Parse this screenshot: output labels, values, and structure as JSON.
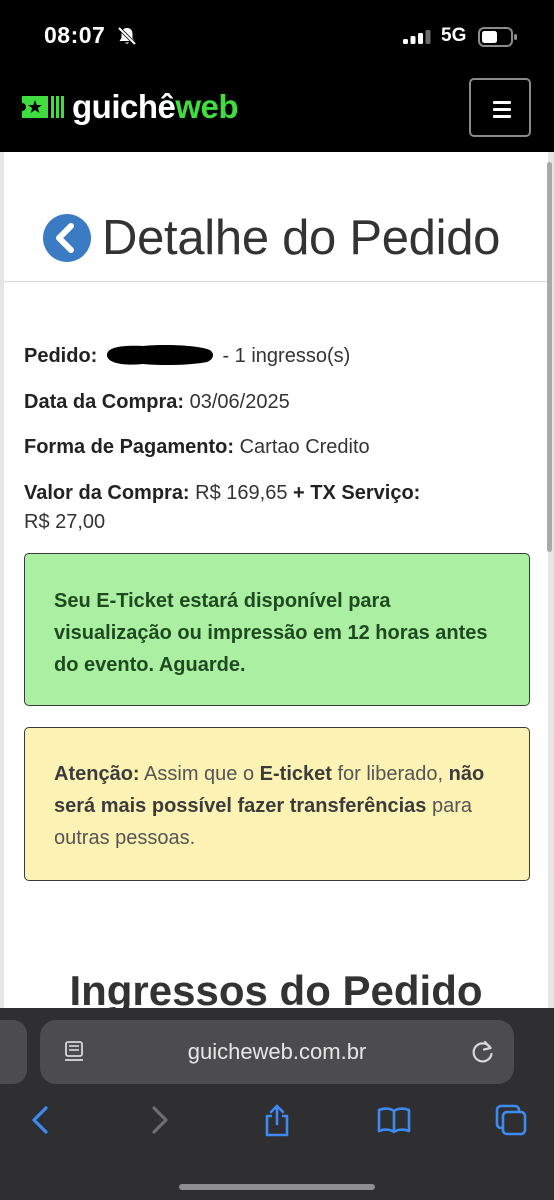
{
  "status": {
    "time": "08:07",
    "network": "5G"
  },
  "header": {
    "logo_part1": "guichê",
    "logo_part2": "web"
  },
  "page": {
    "title": "Detalhe do Pedido",
    "section_title": "Ingressos do Pedido"
  },
  "order": {
    "pedido_label": "Pedido:",
    "pedido_suffix": "- 1 ingresso(s)",
    "data_label": "Data da Compra:",
    "data_value": "03/06/2025",
    "pagamento_label": "Forma de Pagamento:",
    "pagamento_value": "Cartao Credito",
    "valor_label": "Valor da Compra:",
    "valor_value": "R$ 169,65",
    "valor_plus": "+",
    "tx_label": "TX Serviço:",
    "tx_value": "R$ 27,00"
  },
  "alerts": {
    "success": "Seu E-Ticket estará disponível para visualização ou impressão em 12 horas antes do evento. Aguarde.",
    "warning_label": "Atenção:",
    "warning_text1": "Assim que o",
    "warning_eticket": "E-ticket",
    "warning_text2": "for liberado,",
    "warning_bold": "não será mais possível fazer transferências",
    "warning_text3": "para outras pessoas."
  },
  "browser": {
    "url": "guicheweb.com.br"
  },
  "colors": {
    "brand_green": "#3fdd3f",
    "back_blue": "#3b7bc4",
    "success_bg": "#abefa3",
    "warning_bg": "#fbf2b4",
    "safari_blue": "#3d8bf2"
  }
}
